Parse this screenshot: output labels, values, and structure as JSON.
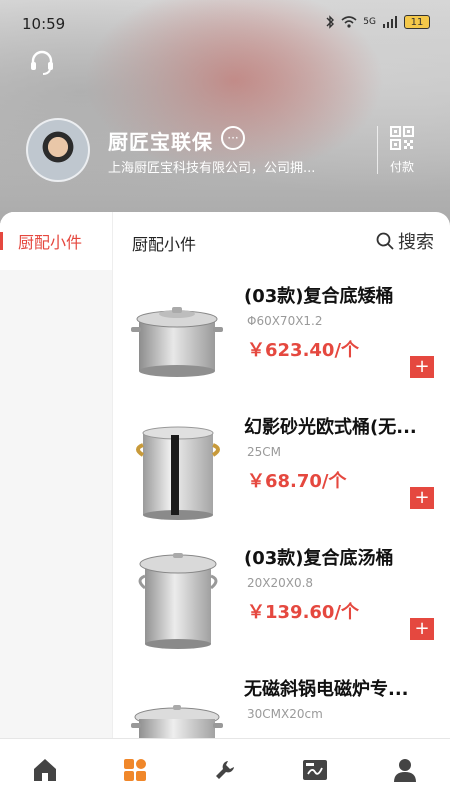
{
  "status_bar": {
    "time": "10:59",
    "network": "5G",
    "battery": "11"
  },
  "profile": {
    "company_name": "厨匠宝联保",
    "company_desc": "上海厨匠宝科技有限公司，公司拥...",
    "more_icon": "ellipsis-circle-icon",
    "pay_label": "付款"
  },
  "sidebar": {
    "items": [
      {
        "label": "厨配小件",
        "active": true
      }
    ]
  },
  "content": {
    "category_title": "厨配小件",
    "search_label": "搜索",
    "products": [
      {
        "name": "(03款)复合底矮桶",
        "spec": "Φ60X70X1.2",
        "price": "￥623.40/个"
      },
      {
        "name": "幻影砂光欧式桶(无...",
        "spec": "25CM",
        "price": "￥68.70/个"
      },
      {
        "name": "(03款)复合底汤桶",
        "spec": "20X20X0.8",
        "price": "￥139.60/个"
      },
      {
        "name": "无磁斜锅电磁炉专...",
        "spec": "30CMX20cm",
        "price": ""
      }
    ]
  },
  "bottom_nav": {
    "items": [
      {
        "icon": "home-icon",
        "active": false
      },
      {
        "icon": "grid-icon",
        "active": true
      },
      {
        "icon": "wrench-icon",
        "active": false
      },
      {
        "icon": "payment-card-icon",
        "active": false
      },
      {
        "icon": "user-icon",
        "active": false
      }
    ]
  },
  "colors": {
    "accent": "#e5483f",
    "inactive_icon": "#444444"
  }
}
